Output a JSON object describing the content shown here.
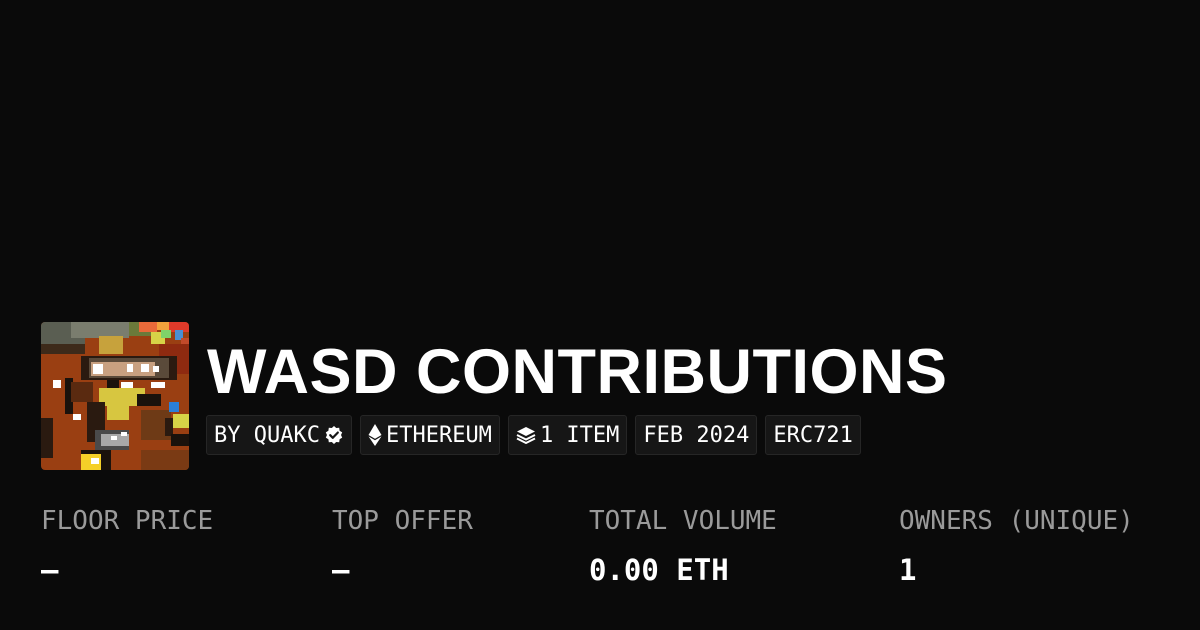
{
  "collection": {
    "title": "WASD CONTRIBUTIONS",
    "avatar_icon": "pixel-art-collection-image"
  },
  "tags": {
    "creator": "BY QUAKC",
    "creator_icon": "verified-badge-icon",
    "chain": "ETHEREUM",
    "chain_icon": "ethereum-icon",
    "items": "1 ITEM",
    "items_icon": "layers-icon",
    "date": "FEB 2024",
    "standard": "ERC721"
  },
  "stats": [
    {
      "label": "FLOOR PRICE",
      "value": "–"
    },
    {
      "label": "TOP OFFER",
      "value": "–"
    },
    {
      "label": "TOTAL VOLUME",
      "value": "0.00 ETH"
    },
    {
      "label": "OWNERS (UNIQUE)",
      "value": "1"
    }
  ],
  "colors": {
    "background": "#0a0a0a",
    "tag_background": "#161616",
    "label_gray": "#9a9a9a",
    "text": "#ffffff"
  }
}
